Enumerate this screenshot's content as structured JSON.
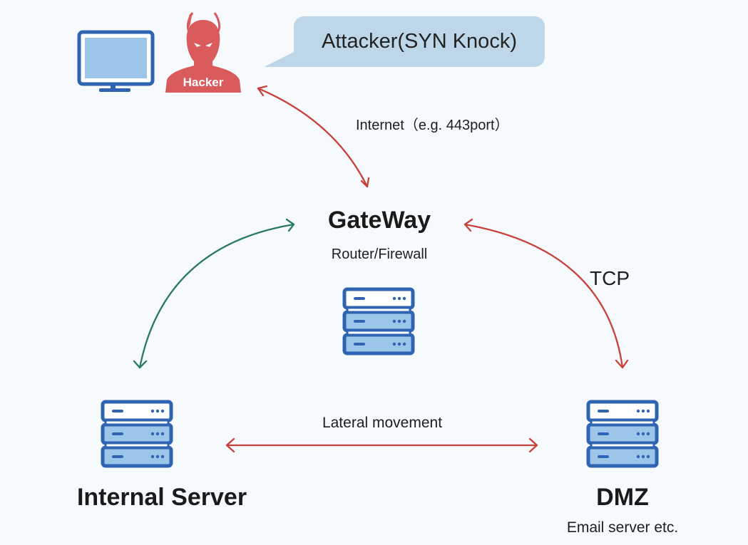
{
  "colors": {
    "background": "#f6fafd",
    "attack_arrow": "#c8423b",
    "internal_arrow": "#2a7a62",
    "server_stroke": "#2f64b3",
    "server_fill": "#9cc5ea",
    "hacker_fill": "#d95b5b",
    "bubble_fill": "#bdd7e9"
  },
  "attacker": {
    "monitor_icon": "computer-monitor",
    "hacker_icon": "devil-hacker",
    "hacker_label": "Hacker",
    "speech_bubble": "Attacker(SYN Knock)"
  },
  "links": {
    "internet": "Internet（e.g. 443port）",
    "tcp": "TCP",
    "lateral": "Lateral movement"
  },
  "nodes": {
    "gateway": {
      "title": "GateWay",
      "subtitle": "Router/Firewall",
      "icon": "server-rack"
    },
    "internal": {
      "title": "Internal Server",
      "icon": "server-rack"
    },
    "dmz": {
      "title": "DMZ",
      "subtitle": "Email server etc.",
      "icon": "server-rack"
    }
  }
}
